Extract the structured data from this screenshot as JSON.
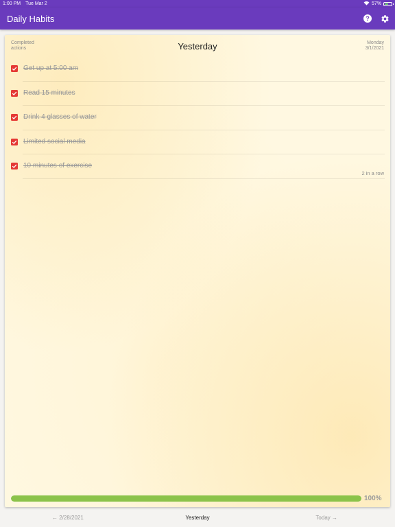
{
  "status_bar": {
    "time": "1:00 PM",
    "date": "Tue Mar 2",
    "battery": "57%",
    "battery_level": 0.57
  },
  "app_bar": {
    "title": "Daily Habits",
    "help_icon": "help-circle-icon",
    "settings_icon": "gear-icon",
    "color": "#6a3bbd"
  },
  "card": {
    "completed_label": "Completed actions",
    "day_title": "Yesterday",
    "weekday": "Monday",
    "date": "3/1/2021"
  },
  "habits": [
    {
      "label": "Get up at 5:00 am",
      "checked": true
    },
    {
      "label": "Read 15 minutes",
      "checked": true
    },
    {
      "label": "Drink 4 glasses of water",
      "checked": true
    },
    {
      "label": "Limited social media",
      "checked": true
    },
    {
      "label": "10 minutes of exercise",
      "checked": true
    }
  ],
  "streak": "2 in a row",
  "progress": {
    "value": 1.0,
    "label": "100%",
    "color": "#8bc34a"
  },
  "bottom_nav": {
    "prev": "← 2/28/2021",
    "current": "Yesterday",
    "next": "Today →"
  }
}
